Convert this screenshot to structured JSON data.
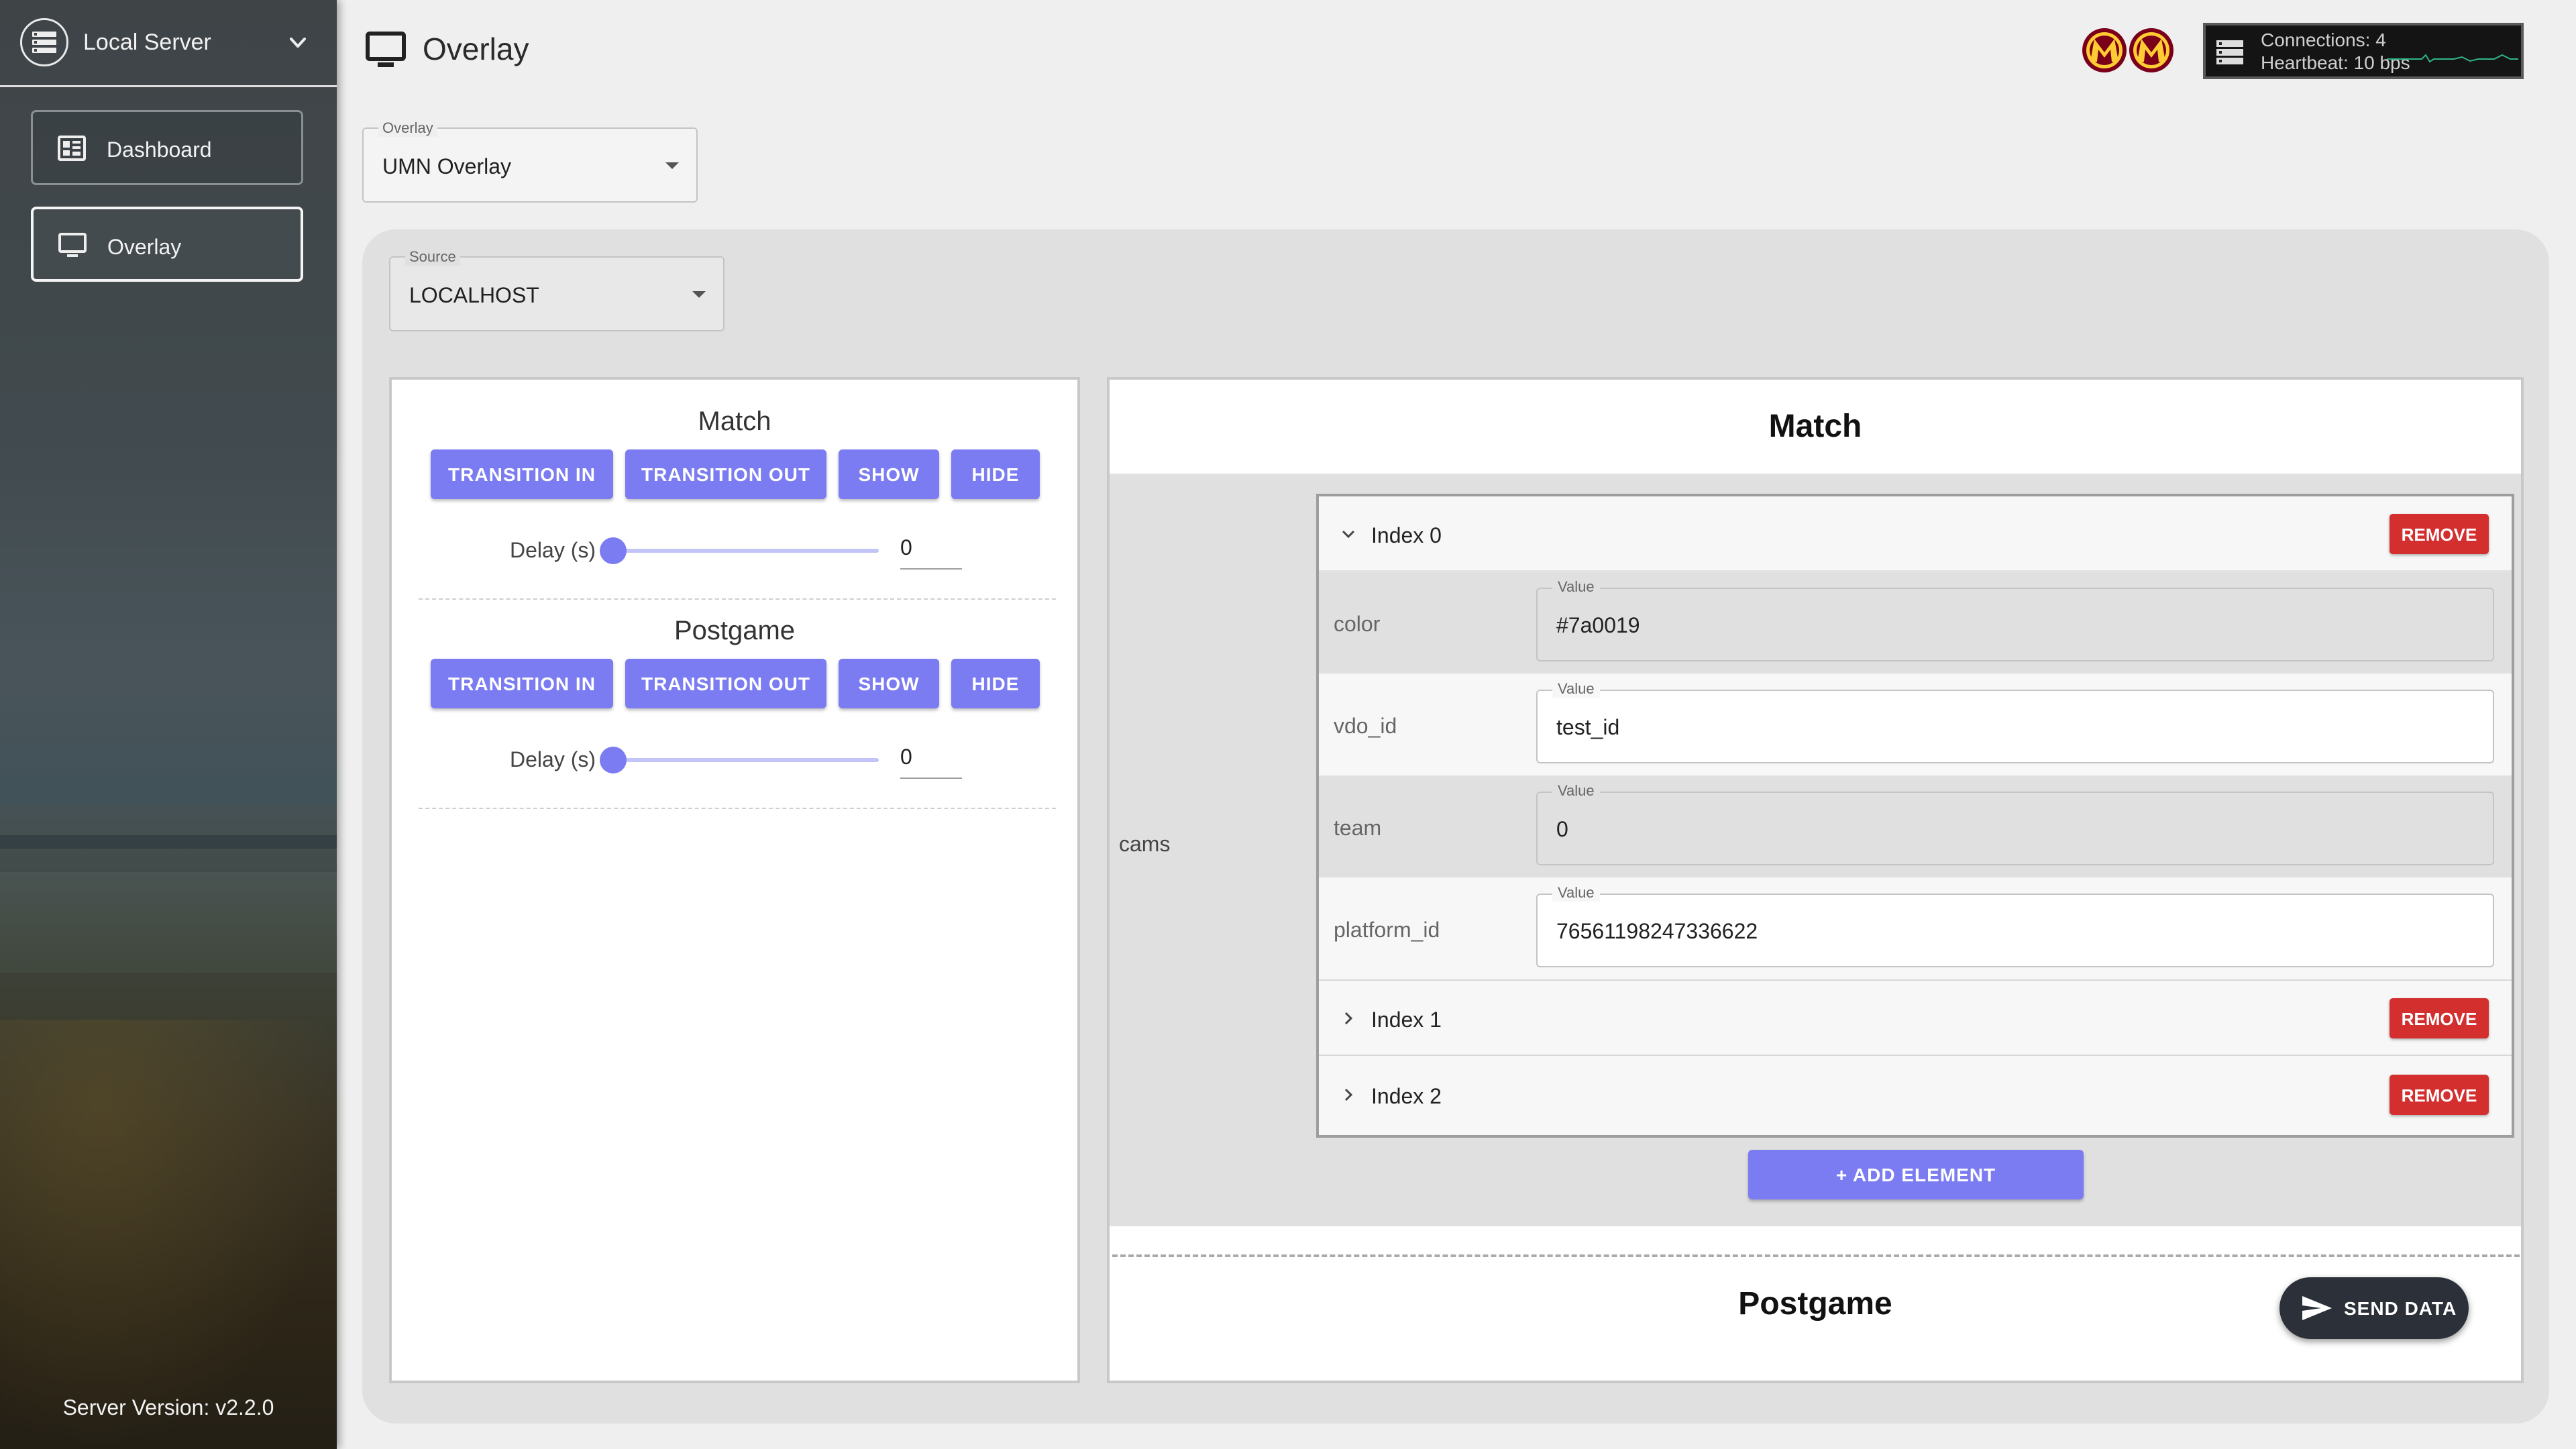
{
  "sidebar": {
    "server_selector": "Local Server",
    "items": [
      {
        "label": "Dashboard",
        "icon": "dashboard-icon"
      },
      {
        "label": "Overlay",
        "icon": "monitor-icon",
        "active": true
      }
    ],
    "server_version": "Server Version: v2.2.0"
  },
  "header": {
    "title": "Overlay",
    "status": {
      "connections": "Connections: 4",
      "heartbeat": "Heartbeat: 10 bps"
    }
  },
  "overlay_select": {
    "label": "Overlay",
    "value": "UMN Overlay"
  },
  "source_select": {
    "label": "Source",
    "value": "LOCALHOST"
  },
  "controls": {
    "sections": [
      {
        "title": "Match",
        "buttons": [
          "TRANSITION IN",
          "TRANSITION OUT",
          "SHOW",
          "HIDE"
        ],
        "delay_label": "Delay (s)",
        "delay_value": "0"
      },
      {
        "title": "Postgame",
        "buttons": [
          "TRANSITION IN",
          "TRANSITION OUT",
          "SHOW",
          "HIDE"
        ],
        "delay_label": "Delay (s)",
        "delay_value": "0"
      }
    ]
  },
  "data_editor": {
    "match_title": "Match",
    "array_key": "cams",
    "remove_label": "REMOVE",
    "field_label": "Value",
    "items": [
      {
        "label": "Index 0",
        "expanded": true,
        "fields": [
          {
            "key": "color",
            "value": "#7a0019"
          },
          {
            "key": "vdo_id",
            "value": "test_id"
          },
          {
            "key": "team",
            "value": "0"
          },
          {
            "key": "platform_id",
            "value": "76561198247336622"
          }
        ]
      },
      {
        "label": "Index 1",
        "expanded": false
      },
      {
        "label": "Index 2",
        "expanded": false
      }
    ],
    "add_label": "+ ADD ELEMENT",
    "postgame_title": "Postgame",
    "send_label": "SEND DATA"
  },
  "colors": {
    "accent": "#7b7cf1",
    "danger": "#d32f2f",
    "logo_maroon": "#7a0019",
    "logo_gold": "#ffcc33",
    "heartbeat_line": "#2fb58a"
  }
}
